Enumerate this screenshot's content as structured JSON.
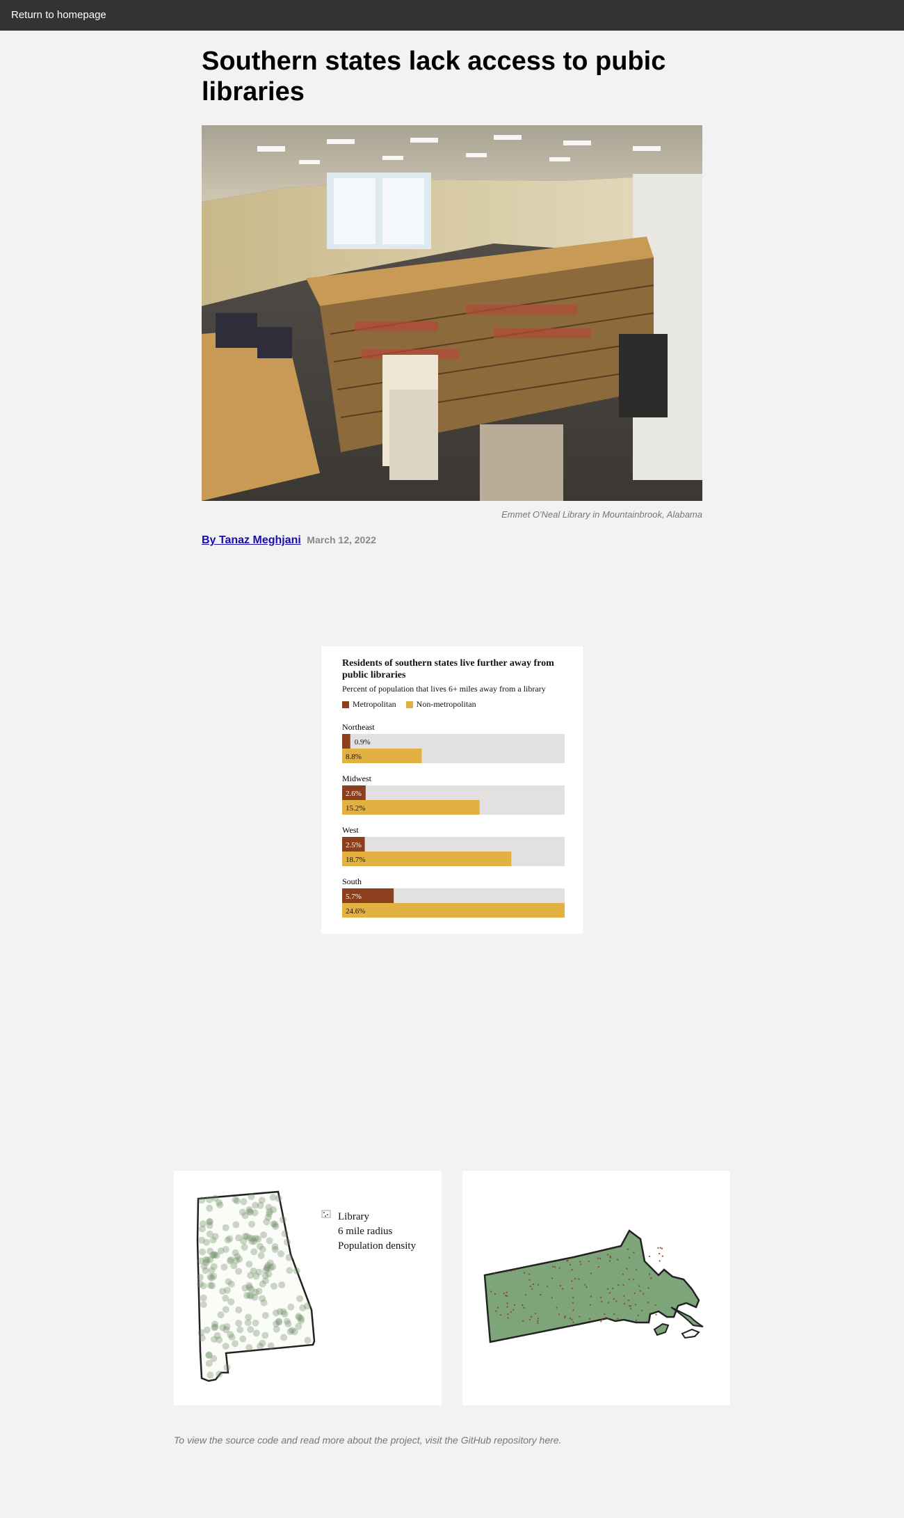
{
  "nav": {
    "home_link": "Return to homepage"
  },
  "article": {
    "title": "Southern states lack access to pubic libraries",
    "photo_caption": "Emmet O'Neal Library in Mountainbrook, Alabama",
    "author": "By Tanaz Meghjani",
    "date": "March 12, 2022"
  },
  "colors": {
    "metro": "#8b3f1c",
    "nonmetro": "#e3b042",
    "track": "#e2e1df",
    "header_bg": "#333333",
    "page_bg": "#f2f2f2"
  },
  "chart_data": {
    "type": "bar",
    "title": "Residents of southern states live further away from public libraries",
    "subtitle": "Percent of population that lives 6+ miles away from a library",
    "legend": [
      "Metropolitan",
      "Non-metropolitan"
    ],
    "xlim": [
      0,
      24.6
    ],
    "categories": [
      "Northeast",
      "Midwest",
      "West",
      "South"
    ],
    "series": [
      {
        "name": "Metropolitan",
        "values": [
          0.9,
          2.6,
          2.5,
          5.7
        ],
        "labels": [
          "0.9%",
          "2.6%",
          "2.5%",
          "5.7%"
        ]
      },
      {
        "name": "Non-metropolitan",
        "values": [
          8.8,
          15.2,
          18.7,
          24.6
        ],
        "labels": [
          "8.8%",
          "15.2%",
          "18.7%",
          "24.6%"
        ]
      }
    ]
  },
  "maps": {
    "legend": {
      "library": "Library",
      "radius": "6 mile radius",
      "density": "Population density"
    }
  },
  "footer": {
    "note": "To view the source code and read more about the project, visit the GitHub repository here."
  }
}
